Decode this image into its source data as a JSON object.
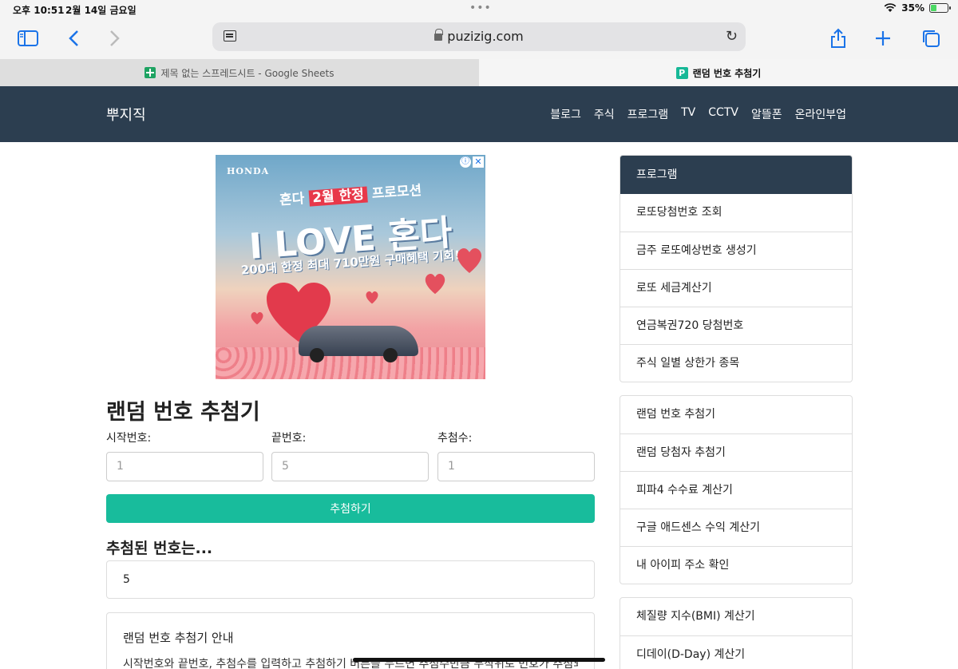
{
  "status_bar": {
    "time": "오후 10:51",
    "date": "2월 14일 금요일",
    "battery": "35%",
    "battery_level": 0.35
  },
  "browser": {
    "url": "puzizig.com",
    "tabs": [
      {
        "label": "제목 없는 스프레드시트 - Google Sheets",
        "icon": "google-sheets-icon",
        "active": false
      },
      {
        "label": "랜덤 번호 추첨기",
        "icon": "puzizig-p-icon",
        "active": true
      }
    ]
  },
  "site": {
    "logo": "뿌지직",
    "nav": [
      "블로그",
      "주식",
      "프로그램",
      "TV",
      "CCTV",
      "알뜰폰",
      "온라인부업"
    ]
  },
  "ad": {
    "brand": "HONDA",
    "line1_prefix": "혼다 ",
    "line1_highlight": "2월 한정",
    "line1_suffix": " 프로모션",
    "line2": "I LOVE 혼다",
    "line3": "200대 한정 최대 710만원 구매혜택 기회!",
    "info_icon": "ⓘ",
    "close_icon": "✕"
  },
  "main": {
    "title": "랜덤 번호 추첨기",
    "start_label": "시작번호:",
    "end_label": "끝번호:",
    "count_label": "추첨수:",
    "start_value": "1",
    "end_value": "5",
    "count_value": "1",
    "draw_button": "추첨하기",
    "result_heading": "추첨된 번호는...",
    "result_value": "5",
    "info_title": "랜덤 번호 추첨기 안내",
    "info_text": "시작번호와 끝번호, 추첨수를 입력하고 추첨하기 버튼을 누르면 추첨수만큼 무작위로 번호가 추첨되"
  },
  "sidebar": {
    "panel1": {
      "header": "프로그램",
      "items": [
        "로또당첨번호 조회",
        "금주 로또예상번호 생성기",
        "로또 세금계산기",
        "연금복권720 당첨번호",
        "주식 일별 상한가 종목"
      ]
    },
    "panel2": {
      "items": [
        "랜덤 번호 추첨기",
        "랜덤 당첨자 추첨기",
        "피파4 수수료 계산기",
        "구글 애드센스 수익 계산기",
        "내 아이피 주소 확인"
      ]
    },
    "panel3": {
      "items": [
        "체질량 지수(BMI) 계산기",
        "디데이(D-Day) 계산기"
      ]
    }
  },
  "colors": {
    "header_bg": "#2c3e50",
    "accent": "#18bc9c",
    "browser_blue": "#1a73e8"
  }
}
